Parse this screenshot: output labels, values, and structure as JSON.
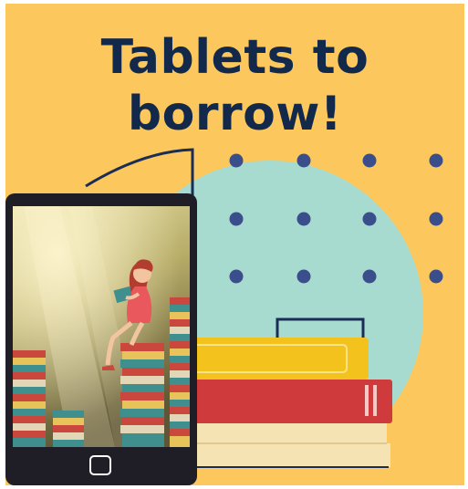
{
  "poster": {
    "title_line1": "Tablets to",
    "title_line2": "borrow!"
  },
  "colors": {
    "background": "#fcc85d",
    "title": "#13294b",
    "circle": "#a7dbcf",
    "dots": "#3b4e8c",
    "tablet_frame": "#1f1e26",
    "book_yellow": "#f4c21c",
    "book_red": "#cf3b3d",
    "book_cream": "#f6e3b4"
  },
  "illustration": {
    "device": "tablet",
    "scene": "woman-reading-on-book-stacks",
    "icons": [
      "home-button-icon",
      "book-stack-icon"
    ]
  }
}
